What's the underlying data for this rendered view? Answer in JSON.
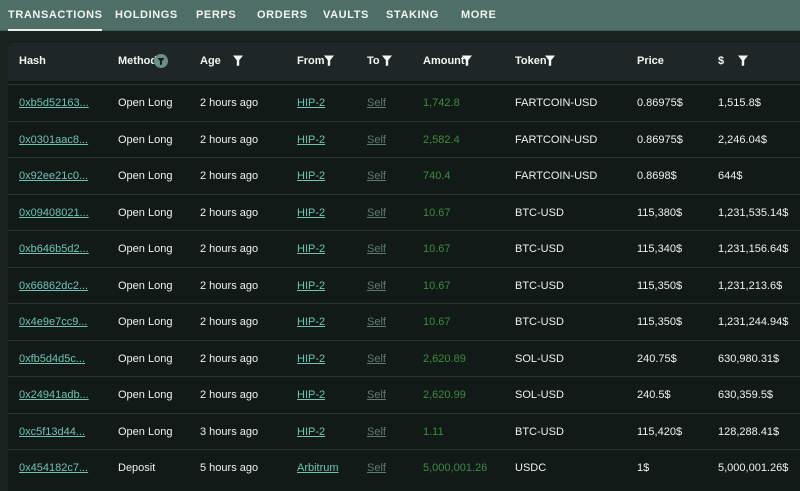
{
  "tabs": [
    {
      "label": "TRANSACTIONS",
      "active": true
    },
    {
      "label": "HOLDINGS",
      "active": false
    },
    {
      "label": "PERPS",
      "active": false
    },
    {
      "label": "ORDERS",
      "active": false
    },
    {
      "label": "VAULTS",
      "active": false
    },
    {
      "label": "STAKING",
      "active": false
    },
    {
      "label": "MORE",
      "active": false
    }
  ],
  "table": {
    "headers": {
      "hash": "Hash",
      "method": "Method",
      "age": "Age",
      "from": "From",
      "to": "To",
      "amount": "Amount",
      "token": "Token",
      "price": "Price",
      "usd": "$"
    },
    "rows": [
      {
        "hash": "0xb5d52163...",
        "method": "Open Long",
        "age": "2 hours ago",
        "from": "HIP-2",
        "to": "Self",
        "amount": "1,742.8",
        "token": "FARTCOIN-USD",
        "price": "0.86975$",
        "usd": "1,515.8$"
      },
      {
        "hash": "0x0301aac8...",
        "method": "Open Long",
        "age": "2 hours ago",
        "from": "HIP-2",
        "to": "Self",
        "amount": "2,582.4",
        "token": "FARTCOIN-USD",
        "price": "0.86975$",
        "usd": "2,246.04$"
      },
      {
        "hash": "0x92ee21c0...",
        "method": "Open Long",
        "age": "2 hours ago",
        "from": "HIP-2",
        "to": "Self",
        "amount": "740.4",
        "token": "FARTCOIN-USD",
        "price": "0.8698$",
        "usd": "644$"
      },
      {
        "hash": "0x09408021...",
        "method": "Open Long",
        "age": "2 hours ago",
        "from": "HIP-2",
        "to": "Self",
        "amount": "10.67",
        "token": "BTC-USD",
        "price": "115,380$",
        "usd": "1,231,535.14$"
      },
      {
        "hash": "0xb646b5d2...",
        "method": "Open Long",
        "age": "2 hours ago",
        "from": "HIP-2",
        "to": "Self",
        "amount": "10.67",
        "token": "BTC-USD",
        "price": "115,340$",
        "usd": "1,231,156.64$"
      },
      {
        "hash": "0x66862dc2...",
        "method": "Open Long",
        "age": "2 hours ago",
        "from": "HIP-2",
        "to": "Self",
        "amount": "10.67",
        "token": "BTC-USD",
        "price": "115,350$",
        "usd": "1,231,213.6$"
      },
      {
        "hash": "0x4e9e7cc9...",
        "method": "Open Long",
        "age": "2 hours ago",
        "from": "HIP-2",
        "to": "Self",
        "amount": "10.67",
        "token": "BTC-USD",
        "price": "115,350$",
        "usd": "1,231,244.94$"
      },
      {
        "hash": "0xfb5d4d5c...",
        "method": "Open Long",
        "age": "2 hours ago",
        "from": "HIP-2",
        "to": "Self",
        "amount": "2,620.89",
        "token": "SOL-USD",
        "price": "240.75$",
        "usd": "630,980.31$"
      },
      {
        "hash": "0x24941adb...",
        "method": "Open Long",
        "age": "2 hours ago",
        "from": "HIP-2",
        "to": "Self",
        "amount": "2,620.99",
        "token": "SOL-USD",
        "price": "240.5$",
        "usd": "630,359.5$"
      },
      {
        "hash": "0xc5f13d44...",
        "method": "Open Long",
        "age": "3 hours ago",
        "from": "HIP-2",
        "to": "Self",
        "amount": "1.11",
        "token": "BTC-USD",
        "price": "115,420$",
        "usd": "128,288.41$"
      },
      {
        "hash": "0x454182c7...",
        "method": "Deposit",
        "age": "5 hours ago",
        "from": "Arbitrum",
        "to": "Self",
        "amount": "5,000,001.26",
        "token": "USDC",
        "price": "1$",
        "usd": "5,000,001.26$"
      }
    ]
  },
  "icons": {
    "filter": "filter-icon",
    "method_filter": "filter-active-icon"
  },
  "colors": {
    "topbar": "#4f6e66",
    "link": "#6fc3b0",
    "amount": "#3d8a3e",
    "self": "#5f7a73"
  }
}
